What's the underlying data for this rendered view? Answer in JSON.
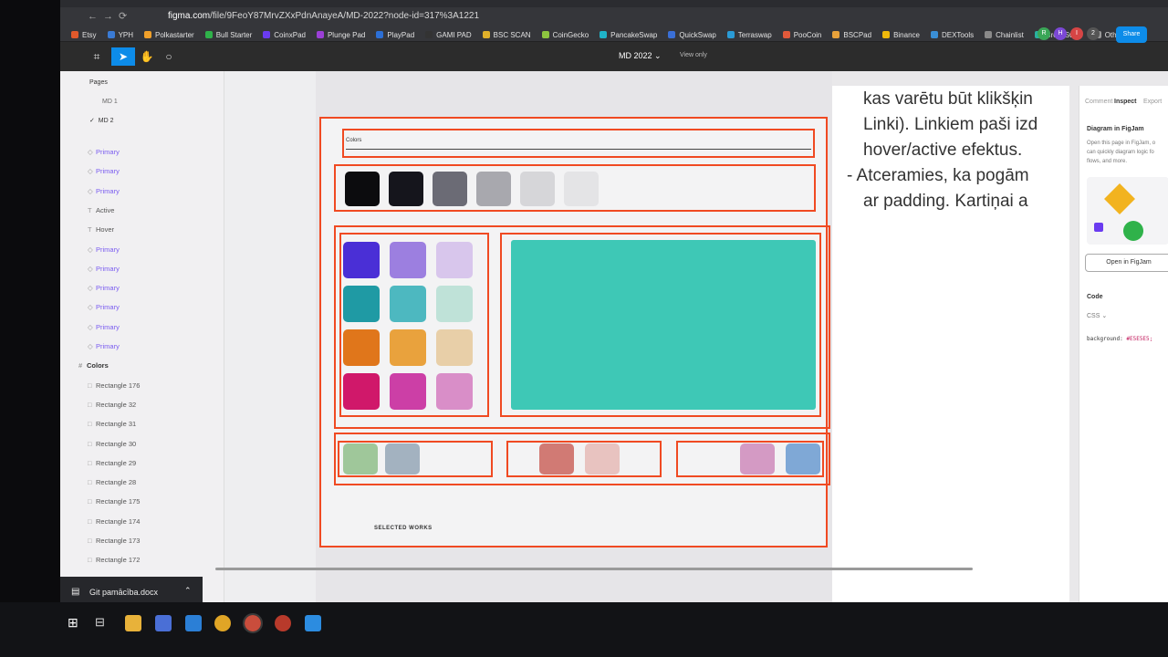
{
  "browser": {
    "url_domain": "figma.com",
    "url_path": "/file/9FeoY87MrvZXxPdnAnayeA/MD-2022?node-id=317%3A1221"
  },
  "bookmarks": [
    "Etsy",
    "YPH",
    "Polkastarter",
    "Bull Starter",
    "CoinxPad",
    "Plunge Pad",
    "PlayPad",
    "GAMI PAD",
    "BSC SCAN",
    "CoinGecko",
    "PancakeSwap",
    "QuickSwap",
    "Terraswap",
    "PooCoin",
    "BSCPad",
    "Binance",
    "DEXTools",
    "Chainlist",
    "CrossSwap",
    "Other"
  ],
  "figma": {
    "file_title": "MD 2022",
    "view_mode": "View only",
    "share_label": "Share",
    "collaborators": [
      "R",
      "H",
      "I",
      "2"
    ]
  },
  "pages": {
    "header": "Pages",
    "items": [
      "MD 1",
      "MD 2"
    ],
    "selected": "MD 2"
  },
  "layers": [
    {
      "icon": "◇",
      "label": "Primary",
      "style": "prim"
    },
    {
      "icon": "◇",
      "label": "Primary",
      "style": "prim"
    },
    {
      "icon": "◇",
      "label": "Primary",
      "style": "prim"
    },
    {
      "icon": "T",
      "label": "Active",
      "style": ""
    },
    {
      "icon": "T",
      "label": "Hover",
      "style": ""
    },
    {
      "icon": "◇",
      "label": "Primary",
      "style": "prim"
    },
    {
      "icon": "◇",
      "label": "Primary",
      "style": "prim"
    },
    {
      "icon": "◇",
      "label": "Primary",
      "style": "prim"
    },
    {
      "icon": "◇",
      "label": "Primary",
      "style": "prim"
    },
    {
      "icon": "◇",
      "label": "Primary",
      "style": "prim"
    },
    {
      "icon": "◇",
      "label": "Primary",
      "style": "prim"
    },
    {
      "icon": "#",
      "label": "Colors",
      "style": "bold"
    },
    {
      "icon": "□",
      "label": "Rectangle 176",
      "style": ""
    },
    {
      "icon": "□",
      "label": "Rectangle 32",
      "style": ""
    },
    {
      "icon": "□",
      "label": "Rectangle 31",
      "style": ""
    },
    {
      "icon": "□",
      "label": "Rectangle 30",
      "style": ""
    },
    {
      "icon": "□",
      "label": "Rectangle 29",
      "style": ""
    },
    {
      "icon": "□",
      "label": "Rectangle 28",
      "style": ""
    },
    {
      "icon": "□",
      "label": "Rectangle 175",
      "style": ""
    },
    {
      "icon": "□",
      "label": "Rectangle 174",
      "style": ""
    },
    {
      "icon": "□",
      "label": "Rectangle 173",
      "style": ""
    },
    {
      "icon": "□",
      "label": "Rectangle 172",
      "style": ""
    }
  ],
  "canvas": {
    "section_label": "Colors",
    "footer_label": "SELECTED WORKS",
    "gray_swatches": [
      "#0c0c0e",
      "#15151c",
      "#6b6b75",
      "#a8a8ae",
      "#d6d6d9",
      "#e4e4e6"
    ],
    "color_grid": [
      [
        "#4a2fd6",
        "#9c7fe0",
        "#d8c6ec"
      ],
      [
        "#1f9aa4",
        "#4db8c0",
        "#bfe2d8"
      ],
      [
        "#e0761b",
        "#e9a23d",
        "#e8cfa8"
      ],
      [
        "#d0186a",
        "#cc3fa6",
        "#d98ec8"
      ]
    ],
    "big_swatch": "#3ec8b6",
    "bottom_swatches": [
      "#9fc79a",
      "#a3b2c0",
      "#d17a74",
      "#e8c3c0",
      "#d49ac4",
      "#7fa8d6"
    ]
  },
  "document": {
    "lines": [
      "kas varētu būt klikšķin",
      "Linki). Linkiem paši izd",
      "hover/active efektus.",
      "- Atceramies, ka pogām",
      "ar padding. Kartiņai a"
    ]
  },
  "inspect": {
    "tabs": [
      "Comment",
      "Inspect",
      "Export"
    ],
    "active_tab": "Inspect",
    "diagram_title": "Diagram in FigJam",
    "diagram_desc": [
      "Open this page in FigJam, o",
      "can quickly diagram logic fo",
      "flows, and more."
    ],
    "open_button": "Open in FigJam",
    "code_header": "Code",
    "code_lang": "CSS",
    "code_line_prop": "background:",
    "code_line_val": "#E5E5E5;"
  },
  "taskbar": {
    "download_file": "Git pamācība.docx"
  }
}
